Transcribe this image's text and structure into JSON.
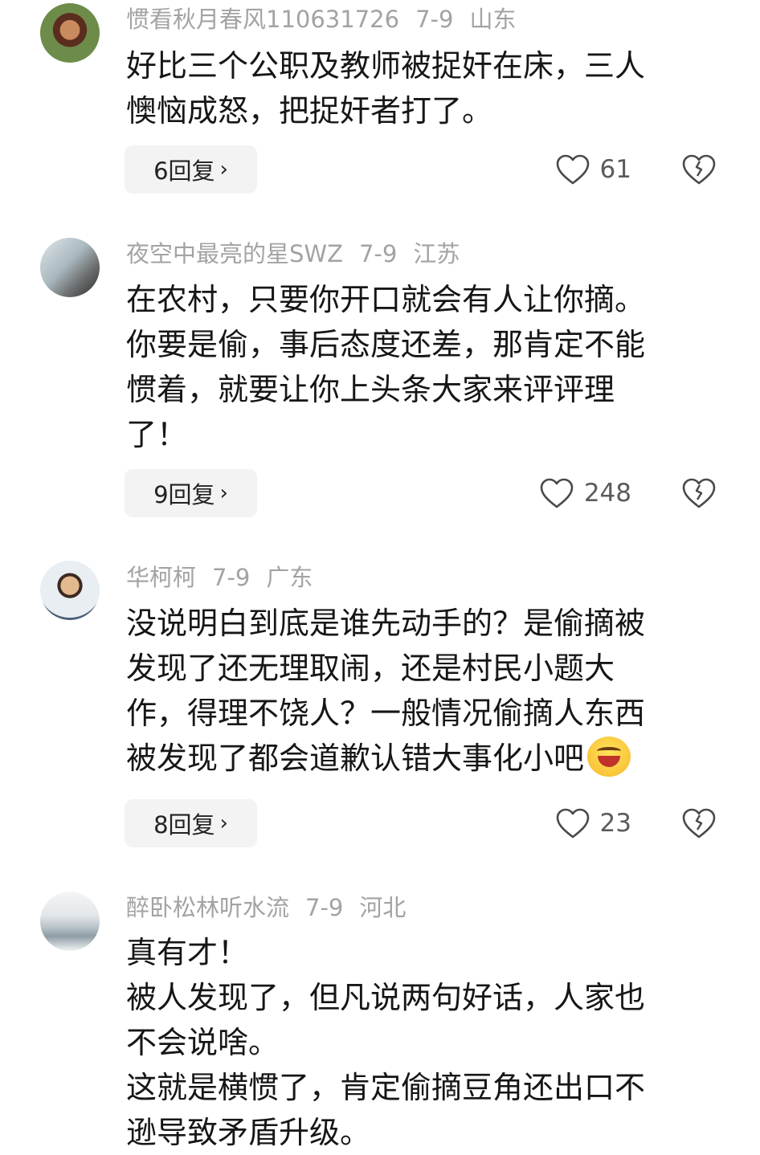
{
  "comments": [
    {
      "username": "惯看秋月春风110631726",
      "date": "7-9",
      "location": "山东",
      "lines": [
        "好比三个公职及教师被捉奸在床，三人",
        "懊恼成怒，把捉奸者打了。"
      ],
      "reply_label": "6回复",
      "likes": "61"
    },
    {
      "username": "夜空中最亮的星SWZ",
      "date": "7-9",
      "location": "江苏",
      "lines": [
        "在农村，只要你开口就会有人让你摘。",
        "你要是偷，事后态度还差，那肯定不能",
        "惯着，就要让你上头条大家来评评理",
        "了！"
      ],
      "reply_label": "9回复",
      "likes": "248"
    },
    {
      "username": "华柯柯",
      "date": "7-9",
      "location": "广东",
      "lines": [
        "没说明白到底是谁先动手的？是偷摘被",
        "发现了还无理取闹，还是村民小题大",
        "作，得理不饶人？一般情况偷摘人东西",
        "被发现了都会道歉认错大事化小吧"
      ],
      "reply_label": "8回复",
      "likes": "23"
    },
    {
      "username": "醉卧松林听水流",
      "date": "7-9",
      "location": "河北",
      "lines": [
        "真有才！",
        "被人发现了，但凡说两句好话，人家也",
        "不会说啥。",
        "这就是横惯了，肯定偷摘豆角还出口不",
        "逊导致矛盾升级。"
      ]
    }
  ],
  "icons": {
    "like": "heart-outline-icon",
    "dislike": "broken-heart-icon",
    "chevron": "chevron-right-icon",
    "emoji": "laughing-emoji-icon"
  }
}
